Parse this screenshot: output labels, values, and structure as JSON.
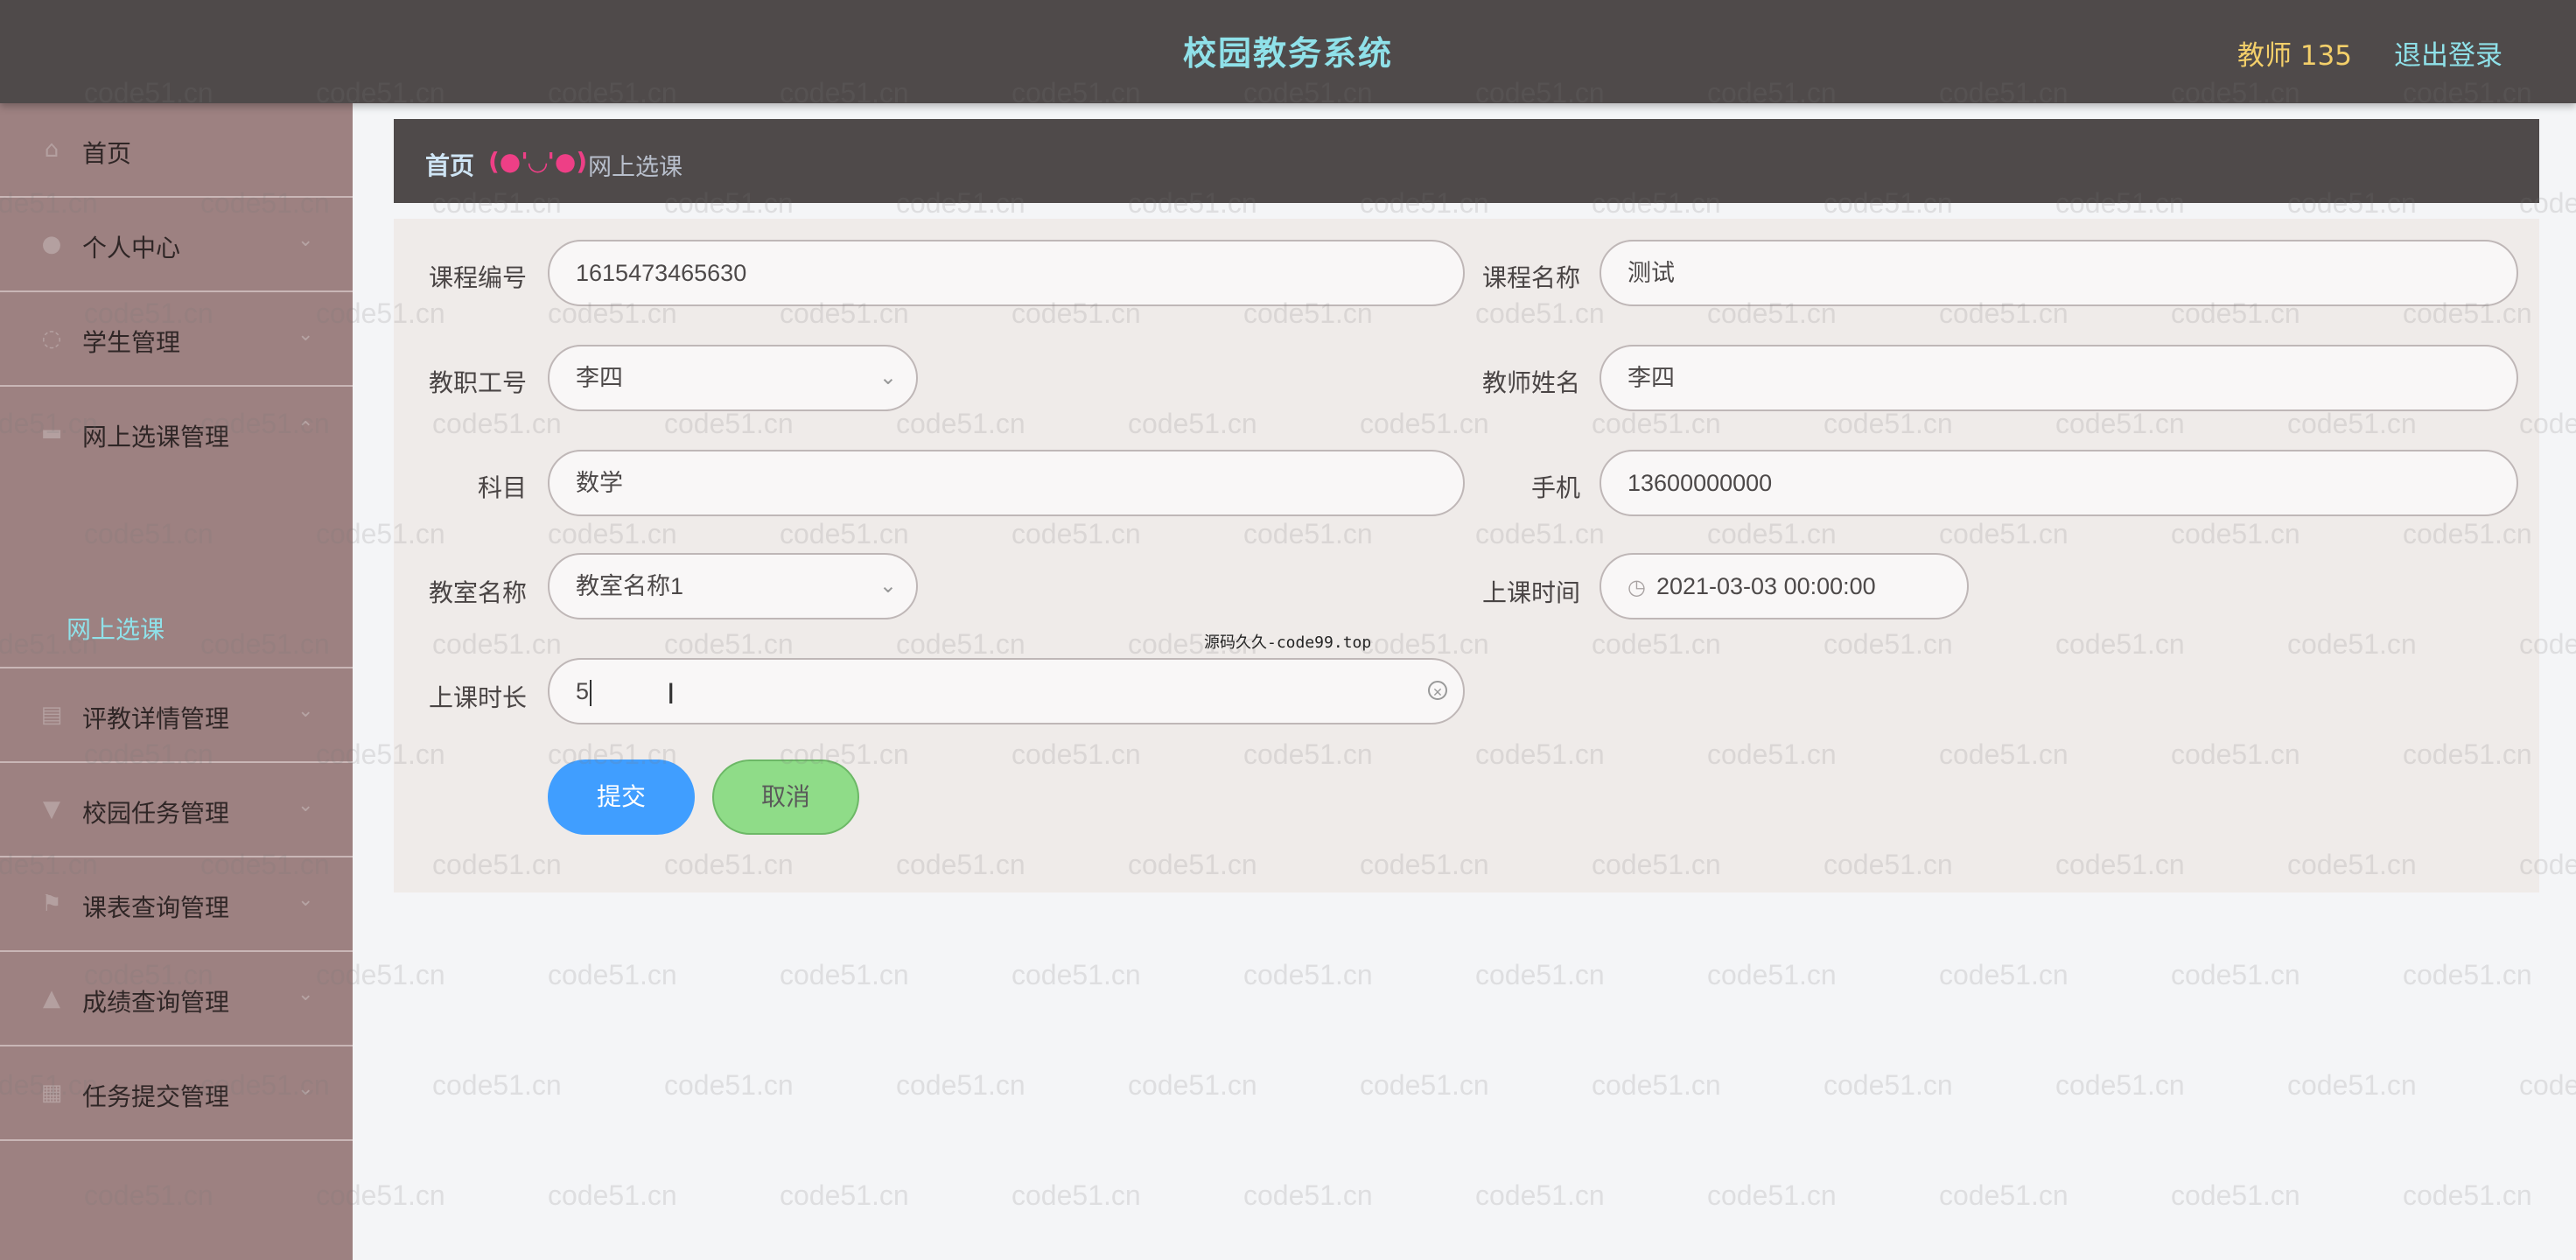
{
  "header": {
    "title": "校园教务系统",
    "user": "教师 135",
    "logout": "退出登录"
  },
  "sidebar": {
    "items": [
      {
        "label": "首页",
        "icon": "home-icon"
      },
      {
        "label": "个人中心",
        "icon": "user-icon"
      },
      {
        "label": "学生管理",
        "icon": "circle-icon"
      },
      {
        "label": "网上选课管理",
        "icon": "folder-icon"
      },
      {
        "label": "评教详情管理",
        "icon": "list-icon"
      },
      {
        "label": "校园任务管理",
        "icon": "cup-icon"
      },
      {
        "label": "课表查询管理",
        "icon": "flag-icon"
      },
      {
        "label": "成绩查询管理",
        "icon": "person-icon"
      },
      {
        "label": "任务提交管理",
        "icon": "grid-icon"
      }
    ],
    "active_sub": "网上选课"
  },
  "breadcrumb": {
    "home": "首页",
    "separator": "(●'◡'●)",
    "current": "网上选课"
  },
  "form": {
    "course_no_label": "课程编号",
    "course_no": "1615473465630",
    "course_name_label": "课程名称",
    "course_name": "测试",
    "teacher_id_label": "教职工号",
    "teacher_id": "李四",
    "teacher_name_label": "教师姓名",
    "teacher_name": "李四",
    "subject_label": "科目",
    "subject": "数学",
    "phone_label": "手机",
    "phone": "13600000000",
    "classroom_label": "教室名称",
    "classroom": "教室名称1",
    "time_label": "上课时间",
    "time": "2021-03-03 00:00:00",
    "duration_label": "上课时长",
    "duration": "5",
    "submit": "提交",
    "cancel": "取消"
  },
  "floating_note": "源码久久-code99.top",
  "watermark": "code51.cn"
}
